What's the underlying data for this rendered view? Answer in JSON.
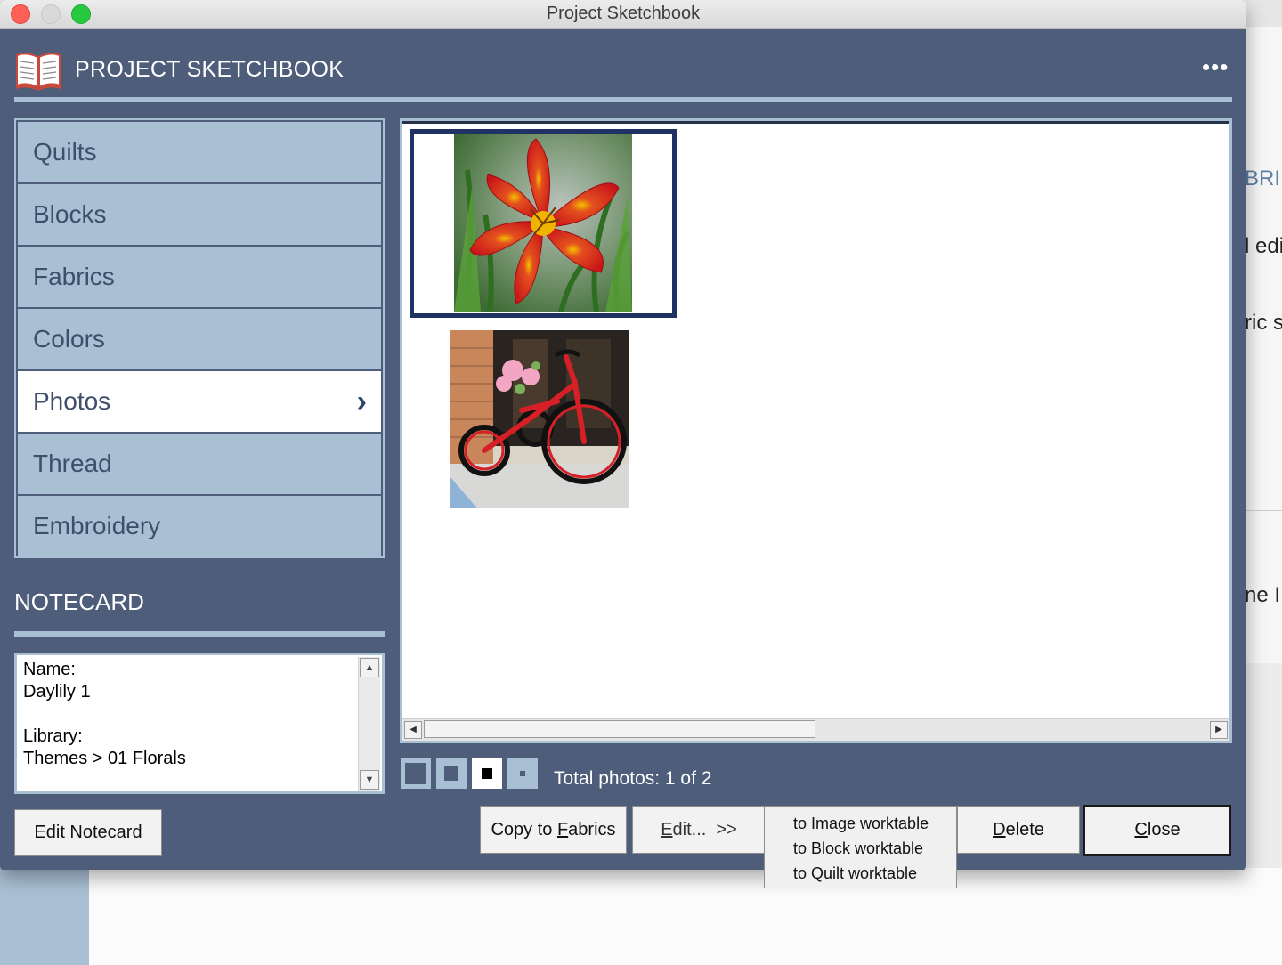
{
  "window": {
    "title": "Project Sketchbook"
  },
  "header": {
    "title": "PROJECT SKETCHBOOK",
    "more_label": "•••",
    "icon": "open-book-icon"
  },
  "categories": [
    {
      "label": "Quilts",
      "selected": false
    },
    {
      "label": "Blocks",
      "selected": false
    },
    {
      "label": "Fabrics",
      "selected": false
    },
    {
      "label": "Colors",
      "selected": false
    },
    {
      "label": "Photos",
      "selected": true
    },
    {
      "label": "Thread",
      "selected": false
    },
    {
      "label": "Embroidery",
      "selected": false
    }
  ],
  "notecard": {
    "title": "NOTECARD",
    "text": "Name:\nDaylily 1\n\nLibrary:\nThemes > 01 Florals",
    "edit_button": "Edit Notecard"
  },
  "photos": {
    "items": [
      {
        "icon": "red-daylily-photo",
        "selected": true
      },
      {
        "icon": "red-tricycle-photo",
        "selected": false
      }
    ],
    "total_text": "Total photos: 1 of 2"
  },
  "view_sizes": [
    "large",
    "medium",
    "small",
    "smallest"
  ],
  "buttons": {
    "copy": {
      "prefix": "Copy to ",
      "mnemonic": "F",
      "suffix": "abrics"
    },
    "edit": {
      "mnemonic": "E",
      "suffix": "dit...  >>"
    },
    "delete": {
      "mnemonic": "D",
      "suffix": "elete"
    },
    "close": {
      "mnemonic": "C",
      "suffix": "lose"
    }
  },
  "edit_menu": [
    "to Image worktable",
    "to Block worktable",
    "to Quilt worktable"
  ],
  "background": {
    "fragments": [
      "BRI",
      "l edi",
      "ric s",
      "ne I"
    ]
  },
  "colors": {
    "panel": "#4d5d7a",
    "accent_light": "#a9c0d4",
    "selection_border": "#1f3263"
  }
}
